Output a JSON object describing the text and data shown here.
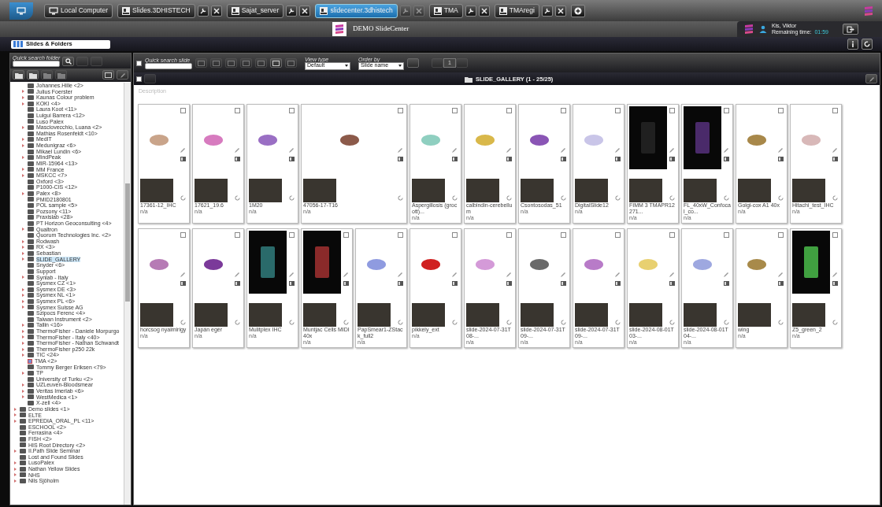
{
  "tabs": [
    {
      "label": "Local Computer",
      "kind": "local",
      "selected": false
    },
    {
      "label": "Slides.3DHISTECH",
      "kind": "server",
      "selected": false
    },
    {
      "label": "Sajat_server",
      "kind": "server",
      "selected": false
    },
    {
      "label": "slidecenter.3dhistech",
      "kind": "server",
      "selected": true
    },
    {
      "label": "TMA",
      "kind": "server",
      "selected": false
    },
    {
      "label": "TMAregi",
      "kind": "server",
      "selected": false
    }
  ],
  "header": {
    "title": "DEMO SlideCenter",
    "user": "Kis, Viktor",
    "remaining_label": "Remaining time:",
    "remaining_time": "01:59"
  },
  "module_select": {
    "value": "Slides & Folders"
  },
  "sidebar": {
    "search_label": "Quick search folder",
    "tree": [
      {
        "children": [
          {
            "label": "Johannes.Hille <2>",
            "kind": "folder",
            "expandable": false,
            "selected": false
          },
          {
            "label": "Julius Foerster",
            "kind": "folder",
            "expandable": true,
            "selected": false
          },
          {
            "label": "Kaunas Colour problem",
            "kind": "folder",
            "expandable": true,
            "selected": false
          },
          {
            "label": "KOKI <4>",
            "kind": "folder",
            "expandable": true,
            "selected": false
          },
          {
            "label": "Laura Koot <11>",
            "kind": "folder",
            "expandable": false,
            "selected": false
          },
          {
            "label": "Luigui Barrera <12>",
            "kind": "folder",
            "expandable": false,
            "selected": false
          },
          {
            "label": "Luso Palex",
            "kind": "folder",
            "expandable": false,
            "selected": false
          },
          {
            "label": "Masciovecchio, Luana <2>",
            "kind": "folder",
            "expandable": true,
            "selected": false
          },
          {
            "label": "Mathias Rosenfeldt <10>",
            "kind": "folder",
            "expandable": false,
            "selected": false
          },
          {
            "label": "MedIT",
            "kind": "folder",
            "expandable": true,
            "selected": false
          },
          {
            "label": "Medunigraz <6>",
            "kind": "folder",
            "expandable": true,
            "selected": false
          },
          {
            "label": "Mikael Lundin <6>",
            "kind": "folder",
            "expandable": false,
            "selected": false
          },
          {
            "label": "MindPeak",
            "kind": "folder",
            "expandable": true,
            "selected": false
          },
          {
            "label": "MIR-15964 <13>",
            "kind": "folder",
            "expandable": false,
            "selected": false
          },
          {
            "label": "MM France",
            "kind": "folder",
            "expandable": true,
            "selected": false
          },
          {
            "label": "MSKCC <7>",
            "kind": "folder",
            "expandable": true,
            "selected": false
          },
          {
            "label": "Oxford <3>",
            "kind": "folder",
            "expandable": false,
            "selected": false
          },
          {
            "label": "P1000-CIS <12>",
            "kind": "folder",
            "expandable": false,
            "selected": false
          },
          {
            "label": "Palex <8>",
            "kind": "folder",
            "expandable": true,
            "selected": false
          },
          {
            "label": "PMID2180801",
            "kind": "folder",
            "expandable": false,
            "selected": false
          },
          {
            "label": "POL sample <5>",
            "kind": "folder",
            "expandable": false,
            "selected": false
          },
          {
            "label": "Pozsony <11>",
            "kind": "folder",
            "expandable": false,
            "selected": false
          },
          {
            "label": "Praxislab <28>",
            "kind": "folder",
            "expandable": false,
            "selected": false
          },
          {
            "label": "PT Horizon Geoconsulting <4>",
            "kind": "folder",
            "expandable": false,
            "selected": false
          },
          {
            "label": "Qualtron",
            "kind": "folder",
            "expandable": true,
            "selected": false
          },
          {
            "label": "Quorum Technologies Inc. <2>",
            "kind": "folder",
            "expandable": false,
            "selected": false
          },
          {
            "label": "Rodwash",
            "kind": "folder",
            "expandable": true,
            "selected": false
          },
          {
            "label": "RX <3>",
            "kind": "folder",
            "expandable": true,
            "selected": false
          },
          {
            "label": "Sebastian",
            "kind": "folder",
            "expandable": true,
            "selected": false
          },
          {
            "label": "SLIDE_GALLERY",
            "kind": "folder",
            "expandable": true,
            "selected": true
          },
          {
            "label": "Snyder <6>",
            "kind": "folder",
            "expandable": false,
            "selected": false
          },
          {
            "label": "Support",
            "kind": "folder",
            "expandable": false,
            "selected": false
          },
          {
            "label": "Synlab - Italy",
            "kind": "folder",
            "expandable": true,
            "selected": false
          },
          {
            "label": "Sysmex CZ <1>",
            "kind": "folder",
            "expandable": false,
            "selected": false
          },
          {
            "label": "Sysmex DE <3>",
            "kind": "folder",
            "expandable": true,
            "selected": false
          },
          {
            "label": "Sysmex NL <1>",
            "kind": "folder",
            "expandable": true,
            "selected": false
          },
          {
            "label": "Sysmex PL <6>",
            "kind": "folder",
            "expandable": true,
            "selected": false
          },
          {
            "label": "Sysmex Suisse AG",
            "kind": "folder",
            "expandable": true,
            "selected": false
          },
          {
            "label": "Szipocs Ferenc <4>",
            "kind": "folder",
            "expandable": false,
            "selected": false
          },
          {
            "label": "Taiwan Instrument <2>",
            "kind": "folder",
            "expandable": false,
            "selected": false
          },
          {
            "label": "Tallin <16>",
            "kind": "folder",
            "expandable": true,
            "selected": false
          },
          {
            "label": "ThermoFisher - Daniele Morpurgo",
            "kind": "folder",
            "expandable": true,
            "selected": false
          },
          {
            "label": "ThermoFisher - Italy <40>",
            "kind": "folder",
            "expandable": true,
            "selected": false
          },
          {
            "label": "ThermoFisher - Nathan Schwandt",
            "kind": "folder",
            "expandable": true,
            "selected": false
          },
          {
            "label": "ThermoFisher p250 22k",
            "kind": "folder",
            "expandable": true,
            "selected": false
          },
          {
            "label": "TIC <24>",
            "kind": "folder",
            "expandable": true,
            "selected": false
          },
          {
            "label": "TMA <2>",
            "kind": "tma",
            "expandable": false,
            "selected": false
          },
          {
            "label": "Tommy Berger Eriksen <79>",
            "kind": "folder",
            "expandable": false,
            "selected": false
          },
          {
            "label": "TP",
            "kind": "folder",
            "expandable": true,
            "selected": false
          },
          {
            "label": "University of Turku <2>",
            "kind": "folder",
            "expandable": false,
            "selected": false
          },
          {
            "label": "UZLeuven-Bloodsmear",
            "kind": "folder",
            "expandable": true,
            "selected": false
          },
          {
            "label": "Veritas Imerlab <6>",
            "kind": "folder",
            "expandable": true,
            "selected": false
          },
          {
            "label": "WestMedica <1>",
            "kind": "folder",
            "expandable": true,
            "selected": false
          },
          {
            "label": "X-zell <4>",
            "kind": "folder",
            "expandable": false,
            "selected": false
          }
        ]
      },
      {
        "label": "Demo slides <1>",
        "kind": "folder",
        "expandable": true,
        "selected": false
      },
      {
        "label": "ELTE",
        "kind": "folder",
        "expandable": true,
        "selected": false
      },
      {
        "label": "EPREDIA_ORAL_PL <11>",
        "kind": "folder",
        "expandable": true,
        "selected": false
      },
      {
        "label": "ESCHOOL <2>",
        "kind": "folder",
        "expandable": false,
        "selected": false
      },
      {
        "label": "Ferrasina <4>",
        "kind": "folder",
        "expandable": false,
        "selected": false
      },
      {
        "label": "FISH <2>",
        "kind": "folder",
        "expandable": false,
        "selected": false
      },
      {
        "label": "HIS Root Directory <2>",
        "kind": "folder",
        "expandable": false,
        "selected": false
      },
      {
        "label": "II.Path Slide Seminar",
        "kind": "folder",
        "expandable": true,
        "selected": false
      },
      {
        "label": "Lost and Found Slides",
        "kind": "folder",
        "expandable": false,
        "selected": false
      },
      {
        "label": "LusoPalex",
        "kind": "folder",
        "expandable": true,
        "selected": false
      },
      {
        "label": "Nathan Yellow Slides",
        "kind": "folder",
        "expandable": true,
        "selected": false
      },
      {
        "label": "NHS",
        "kind": "folder",
        "expandable": true,
        "selected": false
      },
      {
        "label": "Nils Sjöholm",
        "kind": "folder",
        "expandable": true,
        "selected": false
      }
    ]
  },
  "toolbar": {
    "select_all_checked": false,
    "search_label": "Quick search slide",
    "view_type": {
      "label": "View type",
      "value": "Default"
    },
    "order_by": {
      "label": "Order by",
      "value": "Slide name"
    },
    "page": "1"
  },
  "gallery": {
    "select_all_checked": false,
    "title": "SLIDE_GALLERY (1 - 25/25)",
    "description_placeholder": "Description",
    "slides": [
      {
        "name": "17361-12_IHC",
        "info": "n/a",
        "kind": "bright",
        "color": "#c9a48a",
        "checked": false
      },
      {
        "name": "17621_19.6",
        "info": "n/a",
        "kind": "bright",
        "color": "#d77bbf",
        "checked": false
      },
      {
        "name": "1M20",
        "info": "n/a",
        "kind": "bright",
        "color": "#9a6fc4",
        "checked": false
      },
      {
        "name": "47056-17-T16",
        "info": "n/a",
        "kind": "wide",
        "color": "#8c5a4a",
        "checked": false
      },
      {
        "name": "Aspergillosis (grocott)...",
        "info": "n/a",
        "kind": "bright",
        "color": "#8fcfc0",
        "checked": false
      },
      {
        "name": "calbindin-cerebellum",
        "info": "n/a",
        "kind": "bright",
        "color": "#d9b84a",
        "checked": false
      },
      {
        "name": "Csontosodas_51",
        "info": "n/a",
        "kind": "bright",
        "color": "#8a55b5",
        "checked": false
      },
      {
        "name": "DigitalSlide12",
        "info": "n/a",
        "kind": "bright",
        "color": "#c9c5e8",
        "checked": false
      },
      {
        "name": "FIMM 3 TMAPR12 271...",
        "info": "n/a",
        "kind": "dark",
        "color": "#202020",
        "checked": false
      },
      {
        "name": "FL_40xW_Confocal_co...",
        "info": "n/a",
        "kind": "dark",
        "color": "#4a2a6a",
        "checked": false
      },
      {
        "name": "Golgi-cox A1 40x",
        "info": "n/a",
        "kind": "bright",
        "color": "#a8884a",
        "checked": false
      },
      {
        "name": "Hitachi_test_IHC",
        "info": "n/a",
        "kind": "bright",
        "color": "#d8b8b8",
        "checked": false
      },
      {
        "name": "horcsog nyalmirigy",
        "info": "n/a",
        "kind": "bright",
        "color": "#b67bb5",
        "checked": false
      },
      {
        "name": "Japán egér",
        "info": "n/a",
        "kind": "bright",
        "color": "#7b3a9a",
        "checked": false
      },
      {
        "name": "Mulitplex IHC",
        "info": "n/a",
        "kind": "dark",
        "color": "#2a6a6a",
        "checked": false
      },
      {
        "name": "Muntjac Cells MIDI 40x",
        "info": "n/a",
        "kind": "dark",
        "color": "#8a2a2a",
        "checked": false
      },
      {
        "name": "PapSmear1-ZStack_full2",
        "info": "n/a",
        "kind": "bright",
        "color": "#8f9be0",
        "checked": false
      },
      {
        "name": "pikkely_ext",
        "info": "n/a",
        "kind": "bright",
        "color": "#d02020",
        "checked": false
      },
      {
        "name": "slide-2024-07-31T08-...",
        "info": "n/a",
        "kind": "bright",
        "color": "#d49ad8",
        "checked": false
      },
      {
        "name": "slide-2024-07-31T09-...",
        "info": "n/a",
        "kind": "bright",
        "color": "#6a6a6a",
        "checked": false
      },
      {
        "name": "slide-2024-07-31T09-...",
        "info": "n/a",
        "kind": "bright",
        "color": "#b87bc8",
        "checked": false
      },
      {
        "name": "slide-2024-08-01T03-...",
        "info": "n/a",
        "kind": "bright",
        "color": "#e8d070",
        "checked": false
      },
      {
        "name": "slide-2024-08-01T04-...",
        "info": "n/a",
        "kind": "bright",
        "color": "#9ea8e0",
        "checked": false
      },
      {
        "name": "wing",
        "info": "n/a",
        "kind": "bright",
        "color": "#a88a4a",
        "checked": false
      },
      {
        "name": "Z5_green_2",
        "info": "n/a",
        "kind": "dark",
        "color": "#40a040",
        "checked": false
      }
    ]
  }
}
